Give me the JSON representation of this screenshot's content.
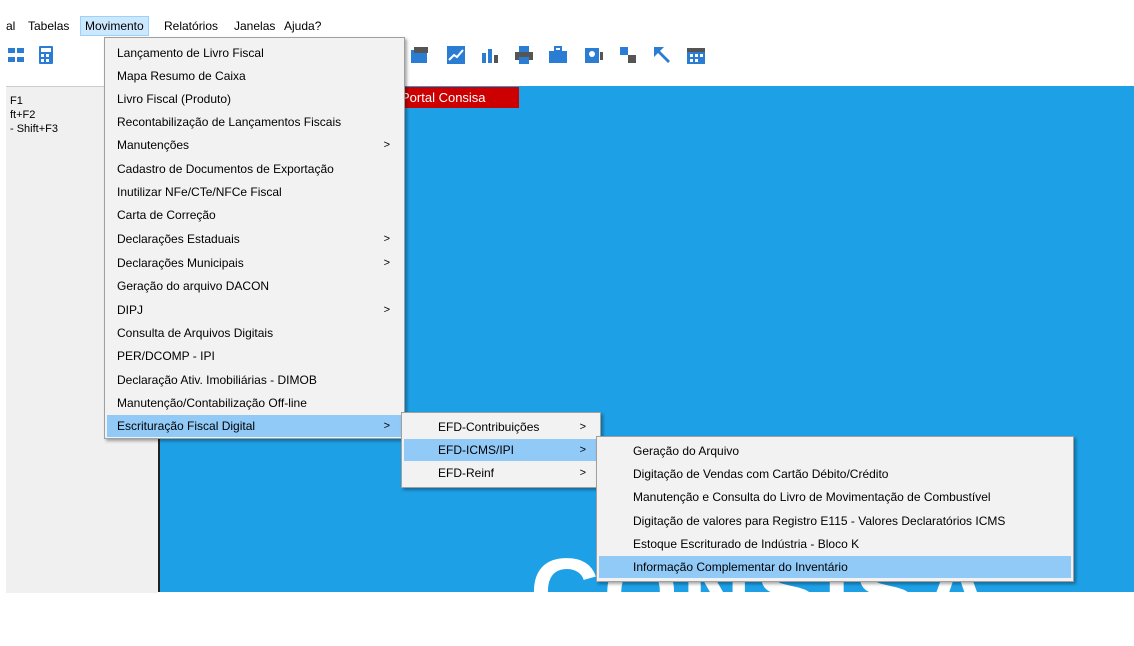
{
  "menubar": {
    "items": [
      {
        "label": "al"
      },
      {
        "label": "Tabelas"
      },
      {
        "label": "Movimento"
      },
      {
        "label": "Relatórios"
      },
      {
        "label": "Janelas"
      },
      {
        "label": "Ajuda?"
      }
    ]
  },
  "left_panel": {
    "items": [
      "F1",
      "ft+F2",
      "- Shift+F3"
    ]
  },
  "banner": {
    "label": "Portal Consisa"
  },
  "movimento_menu": {
    "items": [
      {
        "label": "Lançamento de Livro Fiscal"
      },
      {
        "label": "Mapa Resumo de Caixa"
      },
      {
        "label": "Livro Fiscal (Produto)"
      },
      {
        "label": "Recontabilização de Lançamentos Fiscais"
      },
      {
        "label": "Manutenções",
        "submenu": true
      },
      {
        "label": "Cadastro de Documentos de Exportação"
      },
      {
        "label": "Inutilizar NFe/CTe/NFCe Fiscal"
      },
      {
        "label": "Carta de Correção"
      },
      {
        "label": "Declarações Estaduais",
        "submenu": true
      },
      {
        "label": "Declarações Municipais",
        "submenu": true
      },
      {
        "label": "Geração do arquivo DACON"
      },
      {
        "label": "DIPJ",
        "submenu": true
      },
      {
        "label": "Consulta de Arquivos Digitais"
      },
      {
        "label": "PER/DCOMP - IPI"
      },
      {
        "label": "Declaração Ativ. Imobiliárias - DIMOB"
      },
      {
        "label": "Manutenção/Contabilização Off-line"
      },
      {
        "label": "Escrituração Fiscal Digital",
        "submenu": true,
        "highlighted": true
      }
    ]
  },
  "efd_menu": {
    "items": [
      {
        "label": "EFD-Contribuições",
        "submenu": true
      },
      {
        "label": "EFD-ICMS/IPI",
        "submenu": true,
        "highlighted": true
      },
      {
        "label": "EFD-Reinf",
        "submenu": true
      }
    ]
  },
  "icms_menu": {
    "items": [
      {
        "label": "Geração do Arquivo"
      },
      {
        "label": "Digitação de Vendas com Cartão Débito/Crédito"
      },
      {
        "label": "Manutenção e Consulta do Livro de Movimentação de Combustível"
      },
      {
        "label": "Digitação de valores para Registro E115 - Valores Declaratórios ICMS"
      },
      {
        "label": "Estoque Escriturado de Indústria - Bloco K"
      },
      {
        "label": "Informação Complementar do Inventário",
        "highlighted": true
      }
    ]
  },
  "arrow_glyph": ">",
  "colors": {
    "desktop_blue": "#1ea0e6",
    "banner_red": "#cc0000",
    "menu_highlight": "#91c9f7",
    "menubar_active": "#cce8ff"
  }
}
